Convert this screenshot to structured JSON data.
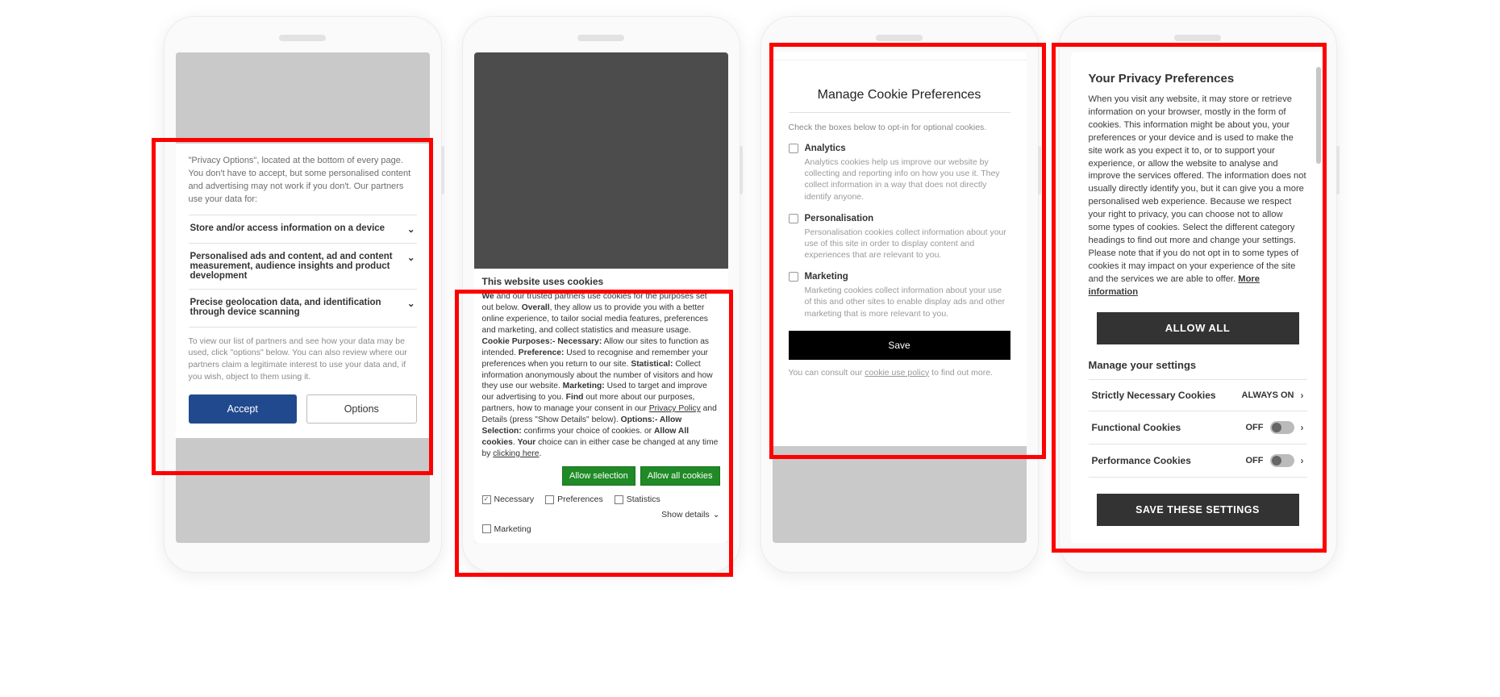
{
  "phone1": {
    "intro": "\"Privacy Options\", located at the bottom of every page. You don't have to accept, but some personalised content and advertising may not work if you don't. Our partners use your data for:",
    "sections": [
      "Store and/or access information on a device",
      "Personalised ads and content, ad and content measurement, audience insights and product development",
      "Precise geolocation data, and identification through device scanning"
    ],
    "note": "To view our list of partners and see how your data may be used, click \"options\" below. You can also review where our partners claim a legitimate interest to use your data and, if you wish, object to them using it.",
    "accept": "Accept",
    "options": "Options"
  },
  "phone2": {
    "title": "This website uses cookies",
    "body_parts": {
      "p1_pre": "We",
      "p1": " and our trusted partners use cookies for the purposes set out below. ",
      "p2_pre": "Overall",
      "p2": ", they allow us to provide you with a better online experience, to tailor social media features, preferences and marketing, and collect statistics and measure usage. ",
      "p3_pre": "Cookie Purposes:- Necessary:",
      "p3": " Allow our sites to function as intended. ",
      "p4_pre": "Preference:",
      "p4": " Used to recognise and remember your preferences when you return to our site. ",
      "p5_pre": "Statistical:",
      "p5": " Collect information anonymously about the number of visitors and how they use our website. ",
      "p6_pre": "Marketing:",
      "p6": " Used to target and improve our advertising to you. ",
      "p7_pre": "Find",
      "p7": " out more about our purposes, partners, how to manage your consent in our ",
      "privacy": "Privacy Policy",
      "p8": " and Details (press \"Show Details\" below). ",
      "p9_pre": "Options:- Allow Selection:",
      "p9": " confirms your choice of cookies. or ",
      "p10_pre": "Allow All cookies",
      "p10": ". ",
      "p11_pre": "Your",
      "p11": " choice can in either case be changed at any time by ",
      "click": "clicking here",
      "end": "."
    },
    "allow_selection": "Allow selection",
    "allow_all": "Allow all cookies",
    "checks": {
      "necessary": "Necessary",
      "preferences": "Preferences",
      "statistics": "Statistics",
      "marketing": "Marketing"
    },
    "details": "Show details"
  },
  "phone3": {
    "title": "Manage Cookie Preferences",
    "sub": "Check the boxes below to opt-in for optional cookies.",
    "items": [
      {
        "name": "Analytics",
        "desc": "Analytics cookies help us improve our website by collecting and reporting info on how you use it. They collect information in a way that does not directly identify anyone."
      },
      {
        "name": "Personalisation",
        "desc": "Personalisation cookies collect information about your use of this site in order to display content and experiences that are relevant to you."
      },
      {
        "name": "Marketing",
        "desc": "Marketing cookies collect information about your use of this and other sites to enable display ads and other marketing that is more relevant to you."
      }
    ],
    "save": "Save",
    "footer_pre": "You can consult our ",
    "footer_link": "cookie use policy",
    "footer_post": " to find out more."
  },
  "phone4": {
    "title": "Your Privacy Preferences",
    "body": "When you visit any website, it may store or retrieve information on your browser, mostly in the form of cookies. This information might be about you, your preferences or your device and is used to make the site work as you expect it to, or to support your experience, or allow the website to analyse and improve the services offered. The information does not usually directly identify you, but it can give you a more personalised web experience. Because we respect your right to privacy, you can choose not to allow some types of cookies. Select the different category headings to find out more and change your settings. Please note that if you do not opt in to some types of cookies it may impact on your experience of the site and the services we are able to offer.  ",
    "more": "More information",
    "allow_all": "ALLOW ALL",
    "manage": "Manage your settings",
    "rows": [
      {
        "name": "Strictly Necessary Cookies",
        "state": "ALWAYS ON"
      },
      {
        "name": "Functional Cookies",
        "state": "OFF"
      },
      {
        "name": "Performance Cookies",
        "state": "OFF"
      }
    ],
    "save": "SAVE THESE SETTINGS"
  }
}
